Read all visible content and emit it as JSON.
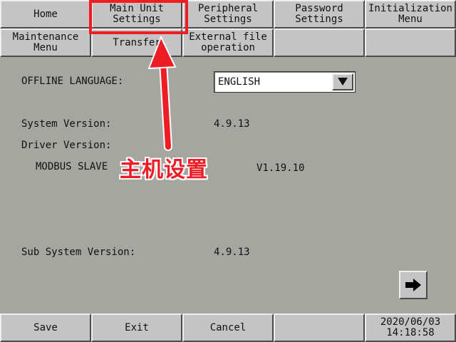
{
  "top_tabs": {
    "home": "Home",
    "main_unit": "Main Unit\nSettings",
    "peripheral": "Peripheral\nSettings",
    "password": "Password\nSettings",
    "initialization": "Initialization\nMenu",
    "maintenance": "Maintenance\nMenu",
    "transfer": "Transfer",
    "external": "External file\noperation"
  },
  "main": {
    "offline_language_label": "OFFLINE LANGUAGE:",
    "language_value": "ENGLISH",
    "system_version_label": "System Version:",
    "system_version_value": "4.9.13",
    "driver_version_label": "Driver Version:",
    "driver_name": "MODBUS SLAVE",
    "driver_version_value": "V1.19.10",
    "sub_system_version_label": "Sub System Version:",
    "sub_system_version_value": "4.9.13"
  },
  "icons": {
    "dropdown": "triangle-down",
    "next": "arrow-right"
  },
  "bottom": {
    "save": "Save",
    "exit": "Exit",
    "cancel": "Cancel",
    "date": "2020/06/03",
    "time": "14:18:58"
  },
  "annotation": {
    "text": "主机设置",
    "color": "#ee1c24"
  }
}
